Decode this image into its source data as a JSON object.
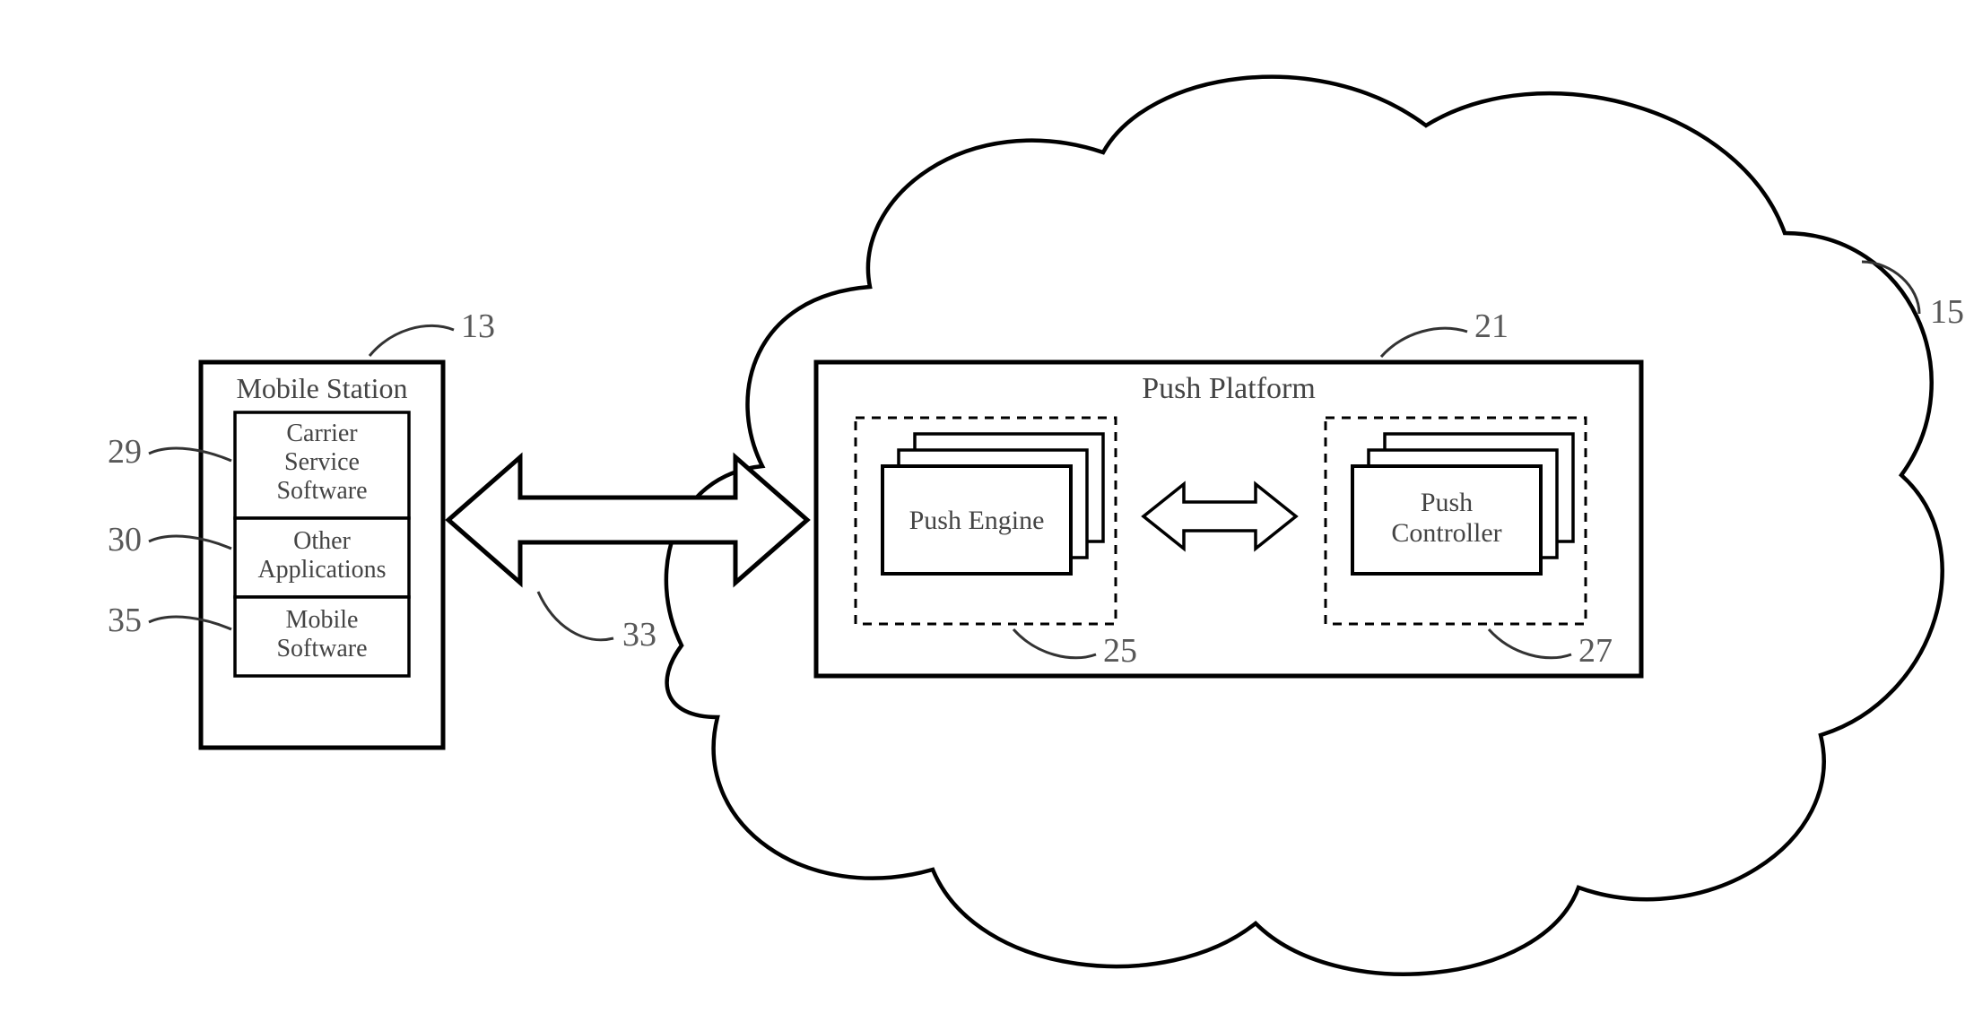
{
  "mobile_station": {
    "title": "Mobile Station",
    "items": [
      {
        "label": "Carrier\nService\nSoftware",
        "ref": "29"
      },
      {
        "label": "Other\nApplications",
        "ref": "30"
      },
      {
        "label": "Mobile\nSoftware",
        "ref": "35"
      }
    ],
    "ref": "13"
  },
  "link": {
    "ref": "33"
  },
  "cloud": {
    "ref": "15"
  },
  "push_platform": {
    "title": "Push Platform",
    "ref": "21",
    "engine": {
      "label": "Push Engine",
      "ref": "25"
    },
    "controller": {
      "label": "Push\nController",
      "ref": "27"
    }
  }
}
